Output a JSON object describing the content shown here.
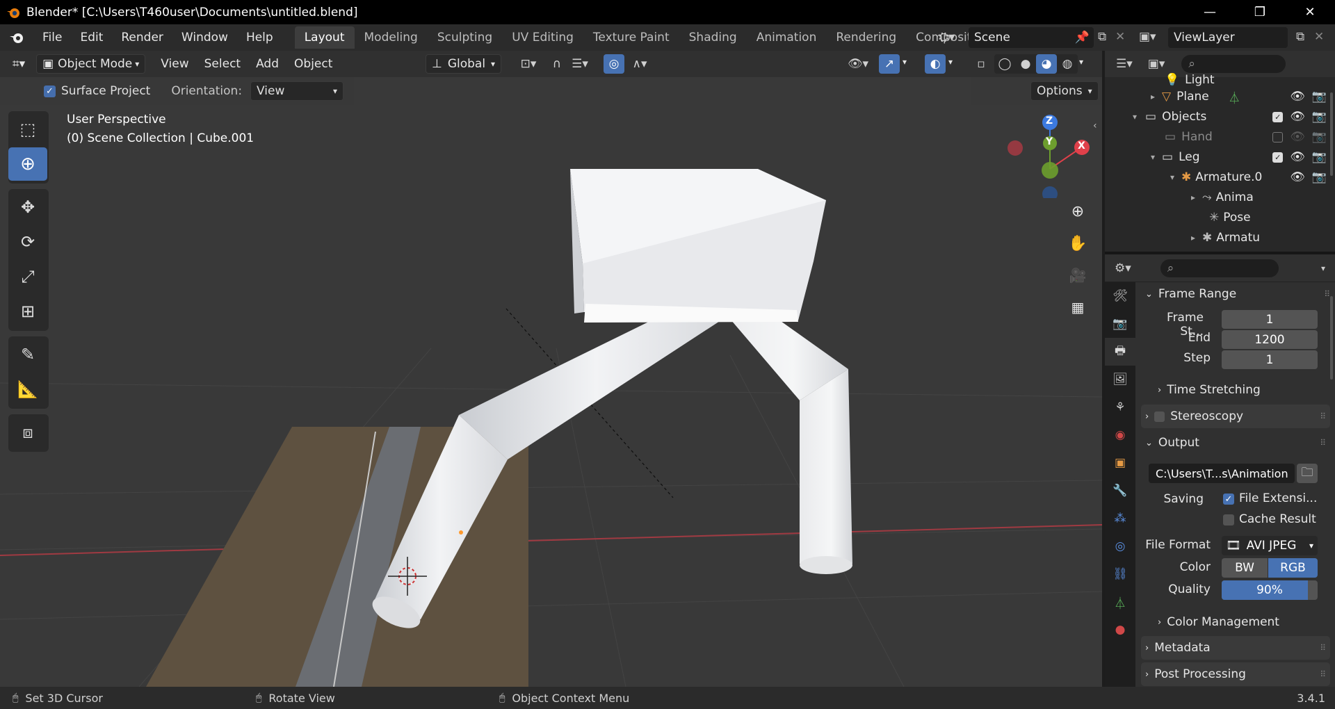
{
  "window": {
    "title": "Blender* [C:\\Users\\T460user\\Documents\\untitled.blend]",
    "minimize_glyph": "—",
    "restore_glyph": "❐",
    "close_glyph": "✕"
  },
  "menu": {
    "items": [
      "File",
      "Edit",
      "Render",
      "Window",
      "Help"
    ]
  },
  "workspaces": {
    "tabs": [
      "Layout",
      "Modeling",
      "Sculpting",
      "UV Editing",
      "Texture Paint",
      "Shading",
      "Animation",
      "Rendering",
      "Compositing"
    ],
    "active": "Layout"
  },
  "scene": {
    "name": "Scene"
  },
  "view_layer": {
    "name": "ViewLayer"
  },
  "viewport_header": {
    "mode": "Object Mode",
    "menus": [
      "View",
      "Select",
      "Add",
      "Object"
    ],
    "orientation": "Global"
  },
  "tool_settings": {
    "surface_project_label": "Surface Project",
    "surface_project_checked": true,
    "orientation_label": "Orientation:",
    "orientation_value": "View",
    "options_label": "Options"
  },
  "viewport": {
    "perspective": "User Perspective",
    "collection_info": "(0) Scene Collection | Cube.001",
    "axis_z": "Z",
    "axis_y": "Y",
    "axis_x": "X"
  },
  "outliner": {
    "rows": [
      {
        "label": "Light",
        "indent": 1,
        "expand": "",
        "icon": "light-icon"
      },
      {
        "label": "Plane",
        "indent": 1,
        "expand": "▸",
        "icon": "mesh-icon"
      },
      {
        "label": "Objects",
        "indent": 0,
        "expand": "▾",
        "icon": "collection-icon"
      },
      {
        "label": "Hand",
        "indent": 1,
        "expand": "",
        "icon": "collection-icon"
      },
      {
        "label": "Leg",
        "indent": 1,
        "expand": "▾",
        "icon": "collection-icon"
      },
      {
        "label": "Armature.0",
        "indent": 2,
        "expand": "▾",
        "icon": "armature-icon"
      },
      {
        "label": "Anima",
        "indent": 3,
        "expand": "▸",
        "icon": "animation-icon"
      },
      {
        "label": "Pose",
        "indent": 3,
        "expand": "",
        "icon": "pose-icon"
      },
      {
        "label": "Armatu",
        "indent": 3,
        "expand": "▸",
        "icon": "armature-data-icon"
      }
    ]
  },
  "properties": {
    "frame_range": {
      "title": "Frame Range",
      "start_label": "Frame St...",
      "start": "1",
      "end_label": "End",
      "end": "1200",
      "step_label": "Step",
      "step": "1"
    },
    "time_stretching": "Time Stretching",
    "stereoscopy": "Stereoscopy",
    "output": {
      "title": "Output",
      "path": "C:\\Users\\T...s\\Animation",
      "saving_label": "Saving",
      "file_extensions": "File Extensi...",
      "file_extensions_checked": true,
      "cache_result": "Cache Result",
      "cache_result_checked": false,
      "file_format_label": "File Format",
      "file_format": "AVI JPEG",
      "color_label": "Color",
      "color_bw": "BW",
      "color_rgb": "RGB",
      "quality_label": "Quality",
      "quality": "90%",
      "quality_fraction": 0.9
    },
    "color_management": "Color Management",
    "metadata": "Metadata",
    "post_processing": "Post Processing"
  },
  "statusbar": {
    "left": "Set 3D Cursor",
    "middle": "Rotate View",
    "right": "Object Context Menu",
    "version": "3.4.1"
  },
  "colors": {
    "accent_blue": "#4772b3",
    "axis_x": "#e0404a",
    "axis_y": "#6d9e2e",
    "axis_z": "#3c7ae0"
  }
}
